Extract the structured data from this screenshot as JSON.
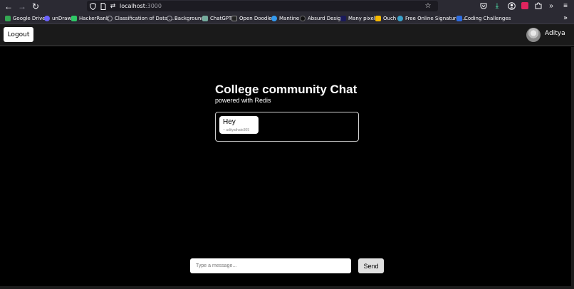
{
  "browser": {
    "url_host": "localhost",
    "url_port": ":3000",
    "icons": {
      "back": "back-arrow-icon",
      "forward": "forward-arrow-icon",
      "reload": "reload-icon",
      "shield": "tracking-shield-icon",
      "page": "page-info-icon",
      "permissions": "permissions-icon",
      "bookmark": "bookmark-star-icon",
      "pocket": "pocket-icon",
      "downloads": "downloads-icon",
      "account": "account-icon",
      "extension": "extension-icon",
      "extensions": "extensions-puzzle-icon",
      "overflow": "overflow-chevron-icon",
      "menu": "hamburger-menu-icon"
    },
    "bookmarks": [
      {
        "label": "Google Drive",
        "color": "#34a853"
      },
      {
        "label": "unDraw",
        "color": "#6c63ff"
      },
      {
        "label": "HackerRank",
        "color": "#2ec866"
      },
      {
        "label": "Classification of Data ...",
        "color": "#9e9ea6"
      },
      {
        "label": "Background",
        "color": "#9e9ea6"
      },
      {
        "label": "ChatGPT",
        "color": "#74aa9c"
      },
      {
        "label": "Open Doodles",
        "color": "#222222"
      },
      {
        "label": "Mantine",
        "color": "#339af0"
      },
      {
        "label": "Absurd Design",
        "color": "#111111"
      },
      {
        "label": "Many pixels",
        "color": "#1a1a5a"
      },
      {
        "label": "Ouch",
        "color": "#f5b800"
      },
      {
        "label": "Free Online Signature ...",
        "color": "#3aa0c8"
      },
      {
        "label": "Coding Challenges",
        "color": "#2d6cdf"
      }
    ]
  },
  "header": {
    "logout_label": "Logout",
    "username": "Aditya"
  },
  "chat": {
    "title": "College community Chat",
    "subtitle": "powered with Redis",
    "messages": [
      {
        "text": "Hey",
        "author": "~ adityathate305"
      }
    ],
    "input_placeholder": "Type a message...",
    "send_label": "Send"
  }
}
